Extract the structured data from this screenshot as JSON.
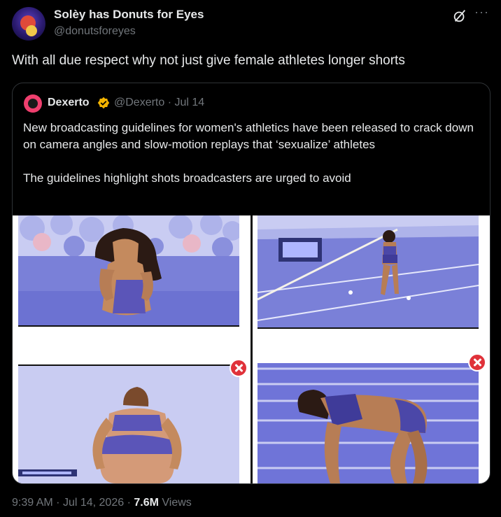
{
  "author": {
    "display_name": "Solèy has Donuts for Eyes",
    "handle": "@donutsforeyes"
  },
  "icons": {
    "grok": "grok-icon",
    "more": "more-icon",
    "verified": "verified-badge-icon",
    "close": "x-mark-icon"
  },
  "more_glyph": "···",
  "tweet": {
    "text": "With all due respect why not just give female athletes longer shorts"
  },
  "quote": {
    "name": "Dexerto",
    "handle": "@Dexerto",
    "sep": "·",
    "date": "Jul 14",
    "paragraph1": "New broadcasting guidelines for women's athletics have been released to crack down on camera angles and slow-motion replays that ‘sexualize’ athletes",
    "paragraph2": "The guidelines highlight shots broadcasters are urged to avoid"
  },
  "footer": {
    "time": "9:39 AM",
    "sep1": "·",
    "date": "Jul 14, 2026",
    "sep2": "·",
    "views_count": "7.6M",
    "views_label": "Views"
  },
  "colors": {
    "background": "#000000",
    "text": "#e7e9ea",
    "muted": "#71767b",
    "illustration_bg": "#c9ccf2",
    "track_blue": "#6f74d8",
    "x_mark": "#e0323a",
    "badge_gold": "#f4b400"
  }
}
